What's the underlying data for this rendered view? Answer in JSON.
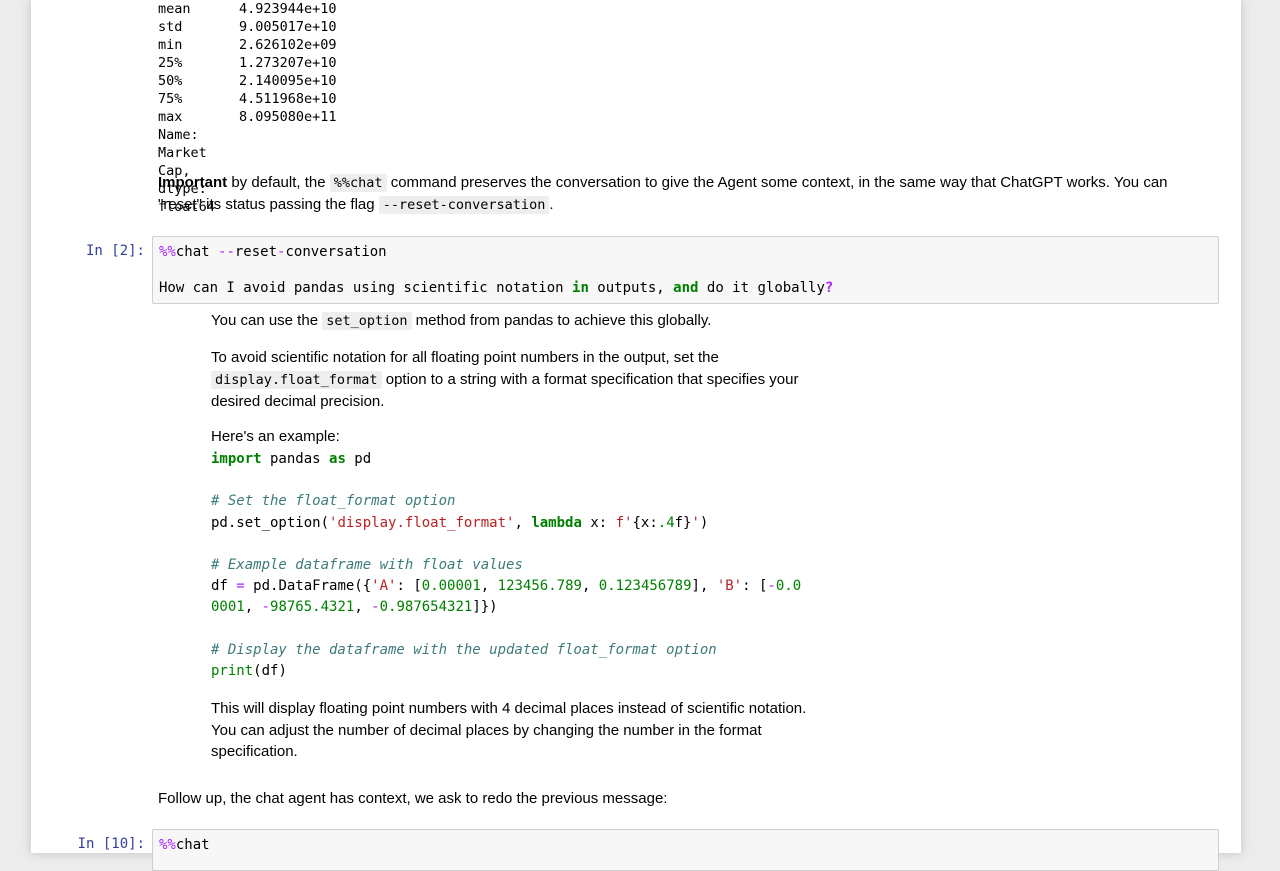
{
  "describe_output": {
    "rows": [
      {
        "key": "mean",
        "value": "4.923944e+10"
      },
      {
        "key": "std",
        "value": "9.005017e+10"
      },
      {
        "key": "min",
        "value": "2.626102e+09"
      },
      {
        "key": "25%",
        "value": "1.273207e+10"
      },
      {
        "key": "50%",
        "value": "2.140095e+10"
      },
      {
        "key": "75%",
        "value": "4.511968e+10"
      },
      {
        "key": "max",
        "value": "8.095080e+11"
      }
    ],
    "footer": "Name: Market Cap, dtype: float64"
  },
  "note": {
    "bold": "Important",
    "text1": " by default, the ",
    "code1": "%%chat",
    "text2": " command preserves the conversation to give the Agent some context, in the same way that ChatGPT works. You can",
    "text3": "\"reset\" its status passing the flag ",
    "code2": "--reset-conversation",
    "text4": "."
  },
  "cell2": {
    "prompt": "In [2]:",
    "magic": "%%",
    "magic_word": "chat",
    "space": " ",
    "flag_dashes": "--",
    "flag_a": "reset",
    "flag_dash": "-",
    "flag_b": "conversation",
    "q_a": "How can I avoid pandas using scientific notation ",
    "q_in": "in",
    "q_b": " outputs, ",
    "q_and": "and",
    "q_c": " do it globally",
    "q_mark": "?"
  },
  "answer": {
    "p1a": "You can use the ",
    "p1code": "set_option",
    "p1b": " method from pandas to achieve this globally.",
    "p2a": "To avoid scientific notation for all floating point numbers in the output, set the",
    "p2code": "display.float_format",
    "p2b": " option to a string with a format specification that specifies your",
    "p2c": "desired decimal precision.",
    "p3": "Here's an example:",
    "code": {
      "l1_import": "import",
      "l1_pandas": " pandas ",
      "l1_as": "as",
      "l1_pd": " pd",
      "c1": "# Set the float_format option",
      "l3_a": "pd.set_option(",
      "l3_s": "'display.float_format'",
      "l3_comma": ", ",
      "l3_lambda": "lambda",
      "l3_x": " x: ",
      "l3_f": "f'",
      "l3_brace": "{x:",
      "l3_fmt": ".4",
      "l3_fend": "f}",
      "l3_q": "'",
      "l3_close": ")",
      "c2": "# Example dataframe with float values",
      "l5_df": "df ",
      "l5_eq": "=",
      "l5_b": " pd.DataFrame({",
      "l5_sA": "'A'",
      "l5_c": ": [",
      "l5_n1": "0.00001",
      "l5_sep1": ", ",
      "l5_n2": "123456.789",
      "l5_sep2": ", ",
      "l5_n3": "0.123456789",
      "l5_d": "], ",
      "l5_sB": "'B'",
      "l5_e": ": [",
      "l5_m1": "-",
      "l5_n4a": "0.0",
      "l6_n4b": "0001",
      "l6_sep": ", ",
      "l6_m2": "-",
      "l6_n5": "98765.4321",
      "l6_sep2": ", ",
      "l6_m3": "-",
      "l6_n6": "0.987654321",
      "l6_end": "]})",
      "c3": "# Display the dataframe with the updated float_format option",
      "l8_print": "print",
      "l8_rest": "(df)"
    },
    "p4a": "This will display floating point numbers with 4 decimal places instead of scientific notation.",
    "p4b": "You can adjust the number of decimal places by changing the number in the format",
    "p4c": "specification."
  },
  "followup": "Follow up, the chat agent has context, we ask to redo the previous message:",
  "cell10": {
    "prompt": "In [10]:",
    "magic": "%%",
    "magic_word": "chat"
  }
}
